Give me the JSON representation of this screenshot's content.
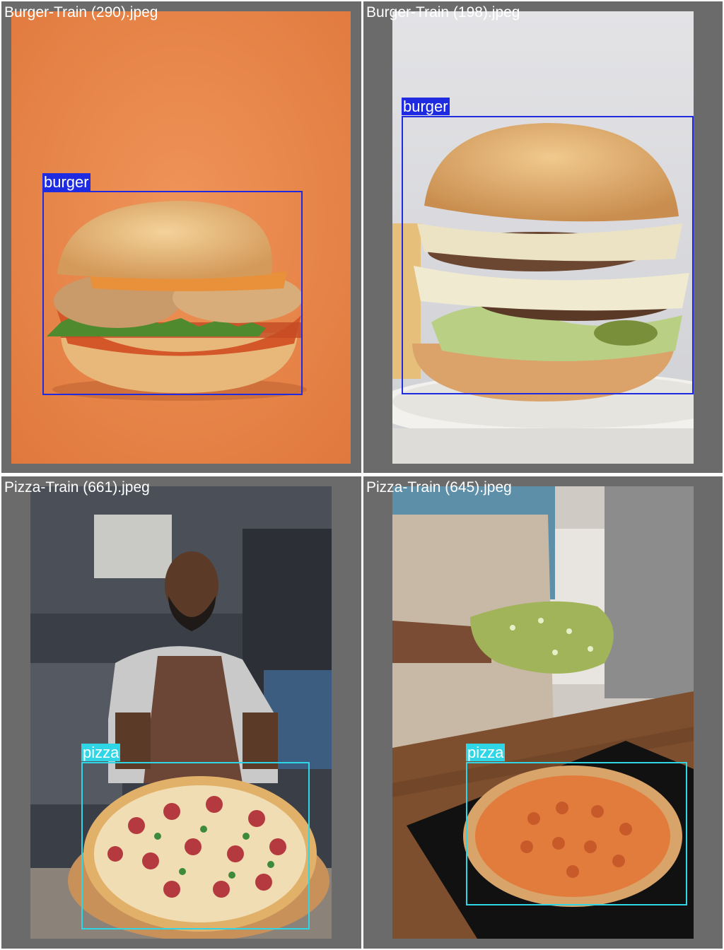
{
  "grid": {
    "images": [
      {
        "file_name": "Burger-Train (290).jpeg",
        "label": "burger",
        "label_color": "#1e2be0"
      },
      {
        "file_name": "Burger-Train (198).jpeg",
        "label": "burger",
        "label_color": "#1e2be0"
      },
      {
        "file_name": "Pizza-Train (661).jpeg",
        "label": "pizza",
        "label_color": "#2fd6e6"
      },
      {
        "file_name": "Pizza-Train (645).jpeg",
        "label": "pizza",
        "label_color": "#2fd6e6"
      }
    ],
    "tile_background": "#6b6b6b"
  }
}
